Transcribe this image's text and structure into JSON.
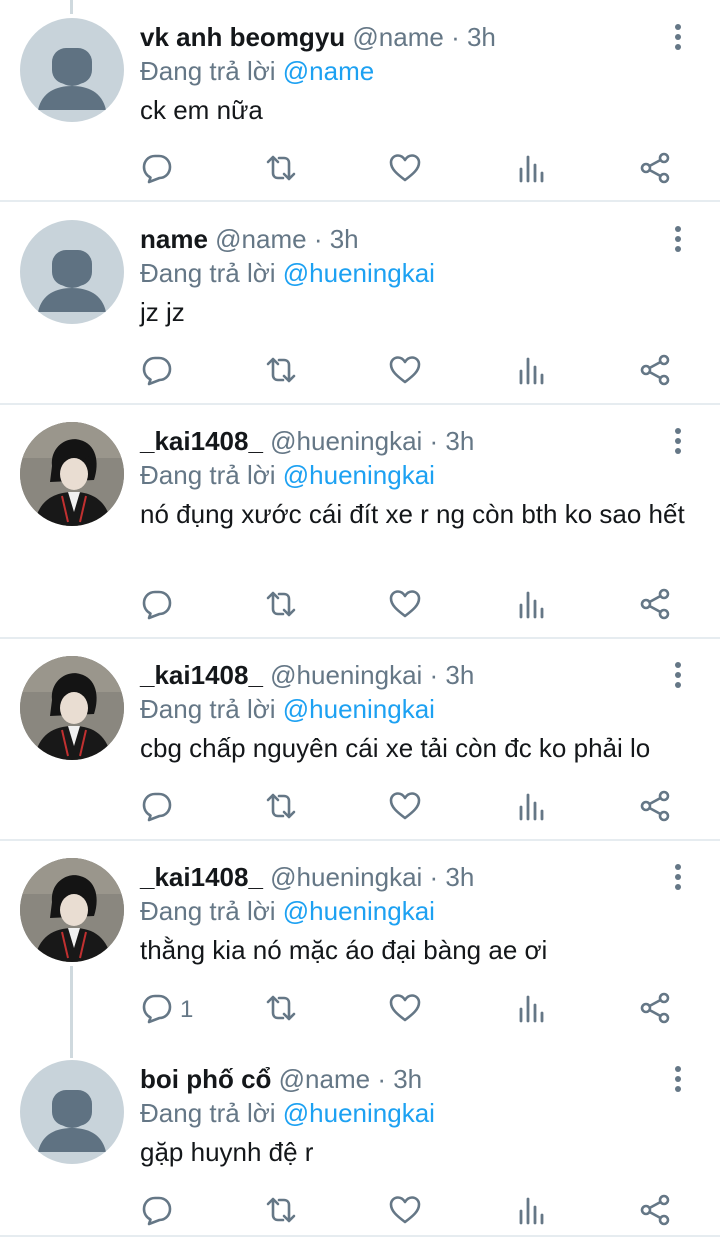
{
  "tweets": [
    {
      "name": "vk anh beomgyu",
      "handle": "@name",
      "time": "· 3h",
      "replying_prefix": "Đang trả lời ",
      "replying_to": "@name",
      "text": "ck em nữa",
      "avatar": "default",
      "reply_count": ""
    },
    {
      "name": "name",
      "handle": "@name",
      "time": "· 3h",
      "replying_prefix": "Đang trả lời ",
      "replying_to": "@hueningkai",
      "text": "jz jz",
      "avatar": "default",
      "reply_count": ""
    },
    {
      "name": "_kai1408_",
      "handle": "@hueningkai",
      "time": "· 3h",
      "replying_prefix": "Đang trả lời ",
      "replying_to": "@hueningkai",
      "text": "nó đụng xước cái đít xe r ng còn bth ko sao hết",
      "avatar": "photo",
      "reply_count": ""
    },
    {
      "name": "_kai1408_",
      "handle": "@hueningkai",
      "time": "· 3h",
      "replying_prefix": "Đang trả lời ",
      "replying_to": "@hueningkai",
      "text": "cbg chấp nguyên cái xe tải còn đc ko phải lo",
      "avatar": "photo",
      "reply_count": ""
    },
    {
      "name": "_kai1408_",
      "handle": "@hueningkai",
      "time": "· 3h",
      "replying_prefix": "Đang trả lời ",
      "replying_to": "@hueningkai",
      "text": "thằng kia nó mặc áo đại bàng ae ơi",
      "avatar": "photo",
      "reply_count": "1"
    },
    {
      "name": "boi phố cổ",
      "handle": "@name",
      "time": "· 3h",
      "replying_prefix": "Đang trả lời ",
      "replying_to": "@hueningkai",
      "text": "gặp huynh đệ r",
      "avatar": "default",
      "reply_count": ""
    }
  ],
  "colors": {
    "link": "#1da1f2",
    "muted": "#657786",
    "text": "#14171a",
    "divider": "#e6ecf0"
  },
  "icons": [
    "more-vertical-icon",
    "reply-icon",
    "retweet-icon",
    "like-icon",
    "stats-icon",
    "share-icon"
  ]
}
